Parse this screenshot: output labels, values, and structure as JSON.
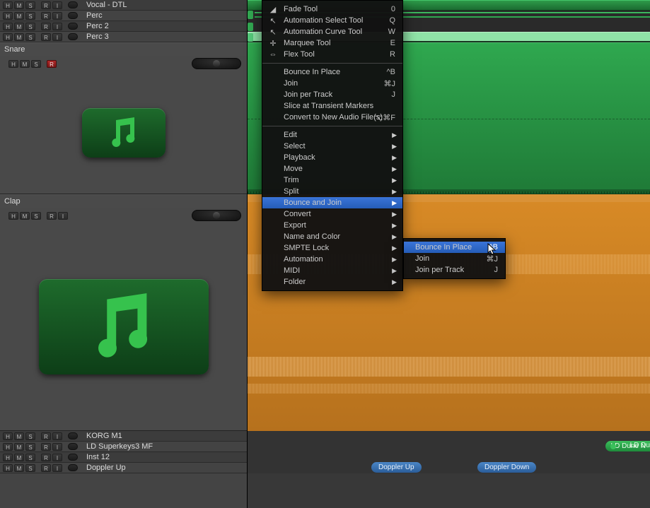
{
  "tracks_top": [
    {
      "name": "Vocal - DTL",
      "buttons": [
        "H",
        "M",
        "S",
        "R",
        "I"
      ]
    },
    {
      "name": "Perc",
      "buttons": [
        "H",
        "M",
        "S",
        "R",
        "I"
      ]
    },
    {
      "name": "Perc 2",
      "buttons": [
        "H",
        "M",
        "S",
        "R",
        "I"
      ]
    },
    {
      "name": "Perc 3",
      "buttons": [
        "H",
        "M",
        "S",
        "R",
        "I"
      ]
    }
  ],
  "big_tracks": [
    {
      "name": "Snare",
      "buttons": [
        "H",
        "M",
        "S",
        "R"
      ],
      "record_armed": true,
      "size": "sm"
    },
    {
      "name": "Clap",
      "buttons": [
        "H",
        "M",
        "S",
        "R",
        "I"
      ],
      "record_armed": false,
      "size": "lg"
    }
  ],
  "tracks_bottom": [
    {
      "name": "KORG M1",
      "buttons": [
        "H",
        "M",
        "S",
        "R",
        "I"
      ]
    },
    {
      "name": "LD Superkeys3 MF",
      "buttons": [
        "H",
        "M",
        "S",
        "R",
        "I"
      ]
    },
    {
      "name": "Inst 12",
      "buttons": [
        "H",
        "M",
        "S",
        "R",
        "I"
      ]
    },
    {
      "name": "Doppler Up",
      "buttons": [
        "H",
        "M",
        "S",
        "R",
        "I"
      ]
    }
  ],
  "context_menu": {
    "tool_section": [
      {
        "label": "Fade Tool",
        "shortcut": "0",
        "icon": "fade"
      },
      {
        "label": "Automation Select Tool",
        "shortcut": "Q",
        "icon": "asel"
      },
      {
        "label": "Automation Curve Tool",
        "shortcut": "W",
        "icon": "acurve"
      },
      {
        "label": "Marquee Tool",
        "shortcut": "E",
        "icon": "marq"
      },
      {
        "label": "Flex Tool",
        "shortcut": "R",
        "icon": "flex"
      }
    ],
    "group2": [
      {
        "label": "Bounce In Place",
        "shortcut": "^B"
      },
      {
        "label": "Join",
        "shortcut": "⌘J"
      },
      {
        "label": "Join per Track",
        "shortcut": "J"
      },
      {
        "label": "Slice at Transient Markers"
      },
      {
        "label": "Convert to New Audio File(s)",
        "shortcut": "⌥⌘F"
      }
    ],
    "group3": [
      {
        "label": "Edit",
        "sub": true
      },
      {
        "label": "Select",
        "sub": true
      },
      {
        "label": "Playback",
        "sub": true
      },
      {
        "label": "Move",
        "sub": true
      },
      {
        "label": "Trim",
        "sub": true
      },
      {
        "label": "Split",
        "sub": true
      },
      {
        "label": "Bounce and Join",
        "sub": true,
        "highlight": true
      },
      {
        "label": "Convert",
        "sub": true
      },
      {
        "label": "Export",
        "sub": true
      },
      {
        "label": "Name and Color",
        "sub": true
      },
      {
        "label": "SMPTE Lock",
        "sub": true
      },
      {
        "label": "Automation",
        "sub": true
      },
      {
        "label": "MIDI",
        "sub": true
      },
      {
        "label": "Folder",
        "sub": true
      }
    ]
  },
  "submenu": [
    {
      "label": "Bounce In Place",
      "shortcut": "^B",
      "highlight": true
    },
    {
      "label": "Join",
      "shortcut": "⌘J"
    },
    {
      "label": "Join per Track",
      "shortcut": "J"
    }
  ],
  "arrange_pills": {
    "doppler_up": "Doppler Up",
    "doppler_down": "Doppler Down",
    "ld_dune": "LD Dune N",
    "ld_du": "LD Du"
  },
  "colors": {
    "green_region": "#1f7a37",
    "orange_region": "#c77a1f",
    "blue_pill": "#2b5d99",
    "menu_hilite": "#2e64c0"
  }
}
